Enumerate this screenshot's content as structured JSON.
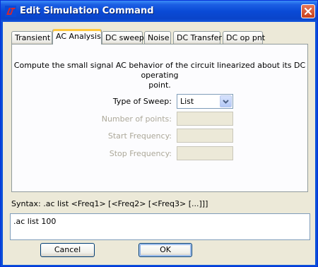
{
  "window": {
    "title": "Edit Simulation Command",
    "app_icon": "ltspice-logo-icon",
    "close_icon": "close-icon"
  },
  "tabs": [
    {
      "label": "Transient",
      "active": false
    },
    {
      "label": "AC Analysis",
      "active": true
    },
    {
      "label": "DC sweep",
      "active": false
    },
    {
      "label": "Noise",
      "active": false
    },
    {
      "label": "DC Transfer",
      "active": false
    },
    {
      "label": "DC op pnt",
      "active": false
    }
  ],
  "panel": {
    "description_line1": "Compute the small signal AC behavior of the circuit linearized about its DC operating",
    "description_line2": "point.",
    "sweep_type": {
      "label": "Type of Sweep:",
      "value": "List"
    },
    "number_of_points": {
      "label": "Number of points:",
      "value": ""
    },
    "start_frequency": {
      "label": "Start Frequency:",
      "value": ""
    },
    "stop_frequency": {
      "label": "Stop Frequency:",
      "value": ""
    }
  },
  "syntax": "Syntax:  .ac list <Freq1> [<Freq2> [<Freq3> [...]]]",
  "command_text": ".ac list 100",
  "buttons": {
    "cancel": "Cancel",
    "ok": "OK"
  },
  "colors": {
    "title_bar": "#0a4ad6",
    "dialog_bg": "#ece9d8",
    "tab_highlight": "#ffc83c"
  }
}
